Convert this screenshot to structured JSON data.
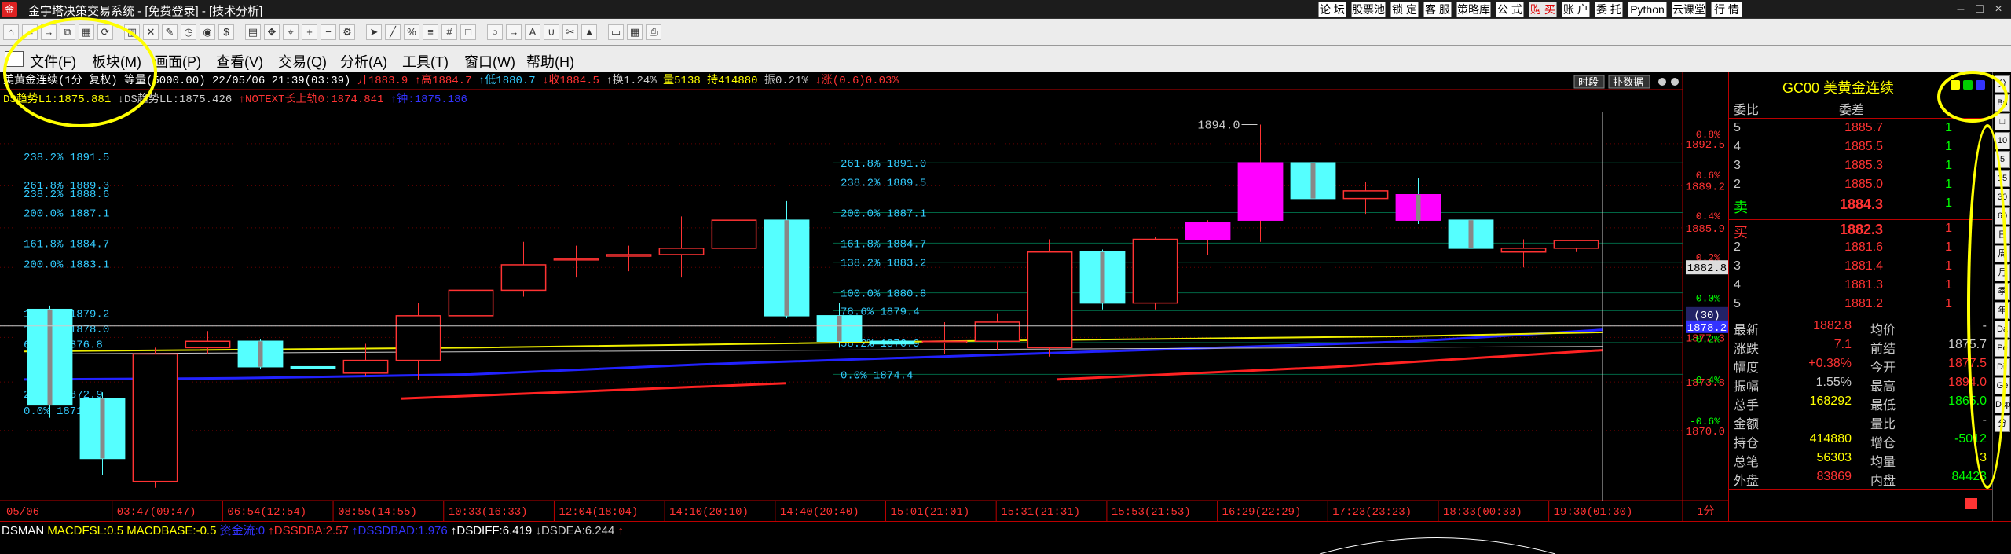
{
  "window": {
    "title": "金宇塔决策交易系统 - [免费登录] - [技术分析]",
    "app_icon": "app-logo-icon",
    "buttons": [
      "论 坛",
      "股票池",
      "锁 定",
      "客 服",
      "策略库",
      "公 式",
      "购 买",
      "账 户",
      "委 托",
      "Python",
      "云课堂",
      "行 情"
    ],
    "minimize": "–",
    "maximize": "□",
    "close": "×"
  },
  "toolbar": {
    "icons": [
      "home-icon",
      "back-icon",
      "forward-icon",
      "copy-icon",
      "grid-icon",
      "refresh-icon",
      "chart-type-icon",
      "trash-icon",
      "edit-icon",
      "clock-icon",
      "record-icon",
      "dollar-icon",
      "layout-icon",
      "move-icon",
      "crosshair-icon",
      "zoom-in-icon",
      "zoom-out-icon",
      "gear-icon",
      "cursor-icon",
      "line-icon",
      "percent-icon",
      "bars-icon",
      "grid-lines-icon",
      "rect-icon",
      "circle-icon",
      "arrow-icon",
      "text-icon",
      "magnet-icon",
      "cut-icon",
      "brush-icon",
      "box-icon",
      "calendar-icon",
      "print-icon"
    ]
  },
  "menu": {
    "items": [
      "文件(F)",
      "板块(M)",
      "画面(P)",
      "查看(V)",
      "交易(Q)",
      "分析(A)",
      "工具(T)",
      "窗口(W)",
      "帮助(H)"
    ]
  },
  "chart": {
    "info_line": "美黄金连续(1分 复权) 等量(5000.00) 22/05/06 21:39(03:39)",
    "quote_parts": [
      {
        "text": "开1883.9",
        "color": "#f33"
      },
      {
        "text": "↑高1884.7",
        "color": "#f33"
      },
      {
        "text": "↑低1880.7",
        "color": "#3cf"
      },
      {
        "text": "↓收1884.5",
        "color": "#f33"
      },
      {
        "text": "↑换1.24%",
        "color": "#ccc"
      },
      {
        "text": "量5138",
        "color": "#ff0"
      },
      {
        "text": "持414880",
        "color": "#ff0"
      },
      {
        "text": "振0.21%",
        "color": "#ccc"
      },
      {
        "text": "↓涨(0.6)0.03%",
        "color": "#f33"
      }
    ],
    "indicator_line": [
      {
        "text": "DS趋势L1:1875.881",
        "color": "#ff0"
      },
      {
        "text": "↓DS趋势LL:1875.426",
        "color": "#ccc"
      },
      {
        "text": "↑NOTEXT长上轨0:1874.841",
        "color": "#f33"
      },
      {
        "text": "↑钟:1875.186",
        "color": "#33f"
      }
    ],
    "top_buttons": [
      "时段",
      "扑数据"
    ],
    "price_scale": [
      "1892.5",
      "1889.2",
      "1885.9",
      "1882.8",
      "1878.2",
      "1877.3",
      "1873.8",
      "1870.0"
    ],
    "percent_scale": [
      "0.8%",
      "0.6%",
      "0.4%",
      "0.2%",
      "0.0%",
      "-0.2%",
      "-0.4%",
      "-0.6%"
    ],
    "last_price_tag": "1882.8",
    "period_tag": "(30)",
    "high_label": "1894.0",
    "time_labels": [
      "05/06",
      "03:47(09:47)",
      "06:54(12:54)",
      "08:55(14:55)",
      "10:33(16:33)",
      "12:04(18:04)",
      "14:10(20:10)",
      "14:40(20:40)",
      "15:01(21:01)",
      "15:31(21:31)",
      "15:53(21:53)",
      "16:29(22:29)",
      "17:23(23:23)",
      "18:33(00:33)",
      "19:30(01:30)"
    ],
    "time_end": "1分",
    "fib_left": [
      "238.2% 1891.5",
      "261.8% 1889.3",
      "238.2% 1888.6",
      "200.0% 1887.1",
      "161.8% 1884.7",
      "200.0% 1883.1",
      "161.8% 1879.2",
      "100.0% 1878.0",
      "61.8% 1876.8",
      "23.6% 1872.9",
      "0.0% 1871.6"
    ],
    "fib_mid": [
      "261.8% 1891.0",
      "238.2% 1889.5",
      "200.0% 1887.1",
      "161.8% 1884.7",
      "138.2% 1883.2",
      "100.0% 1880.8",
      "78.6% 1879.4",
      "58.2% 1876.9",
      "0.0% 1874.4"
    ],
    "candles": [
      {
        "o": 1879.5,
        "c": 1872.0,
        "h": 1879.8,
        "l": 1871.0
      },
      {
        "o": 1872.5,
        "c": 1867.8,
        "h": 1873.0,
        "l": 1866.5
      },
      {
        "o": 1866.0,
        "c": 1876.0,
        "h": 1876.5,
        "l": 1865.5
      },
      {
        "o": 1876.5,
        "c": 1877.0,
        "h": 1877.8,
        "l": 1876.0
      },
      {
        "o": 1877.0,
        "c": 1875.0,
        "h": 1877.2,
        "l": 1874.8
      },
      {
        "o": 1875.0,
        "c": 1874.9,
        "h": 1876.5,
        "l": 1874.5
      },
      {
        "o": 1874.5,
        "c": 1875.5,
        "h": 1876.8,
        "l": 1874.3
      },
      {
        "o": 1875.5,
        "c": 1879.0,
        "h": 1880.0,
        "l": 1874.0
      },
      {
        "o": 1879.0,
        "c": 1881.0,
        "h": 1883.5,
        "l": 1878.5
      },
      {
        "o": 1881.0,
        "c": 1883.0,
        "h": 1884.8,
        "l": 1880.5
      },
      {
        "o": 1883.5,
        "c": 1883.5,
        "h": 1884.5,
        "l": 1882.0
      },
      {
        "o": 1883.8,
        "c": 1883.8,
        "h": 1884.5,
        "l": 1882.5
      },
      {
        "o": 1883.8,
        "c": 1884.3,
        "h": 1886.8,
        "l": 1882.0
      },
      {
        "o": 1884.3,
        "c": 1886.5,
        "h": 1888.8,
        "l": 1884.0
      },
      {
        "o": 1886.5,
        "c": 1879.0,
        "h": 1888.0,
        "l": 1878.8
      },
      {
        "o": 1879.0,
        "c": 1877.0,
        "h": 1880.0,
        "l": 1876.5
      },
      {
        "o": 1877.0,
        "c": 1876.8,
        "h": 1877.8,
        "l": 1876.5
      },
      {
        "o": 1877.0,
        "c": 1877.0,
        "h": 1878.5,
        "l": 1876.0
      },
      {
        "o": 1877.0,
        "c": 1878.5,
        "h": 1879.2,
        "l": 1876.3
      },
      {
        "o": 1876.5,
        "c": 1884.0,
        "h": 1885.0,
        "l": 1875.8
      },
      {
        "o": 1884.0,
        "c": 1880.0,
        "h": 1884.2,
        "l": 1879.5
      },
      {
        "o": 1880.0,
        "c": 1885.0,
        "h": 1885.2,
        "l": 1879.5
      },
      {
        "o": 1885.0,
        "c": 1886.3,
        "h": 1886.5,
        "l": 1883.8
      },
      {
        "o": 1886.5,
        "c": 1891.0,
        "h": 1894.0,
        "l": 1884.8
      },
      {
        "o": 1891.0,
        "c": 1888.2,
        "h": 1892.5,
        "l": 1887.8
      },
      {
        "o": 1888.2,
        "c": 1888.8,
        "h": 1889.5,
        "l": 1887.0
      },
      {
        "o": 1888.5,
        "c": 1886.5,
        "h": 1889.8,
        "l": 1886.2
      },
      {
        "o": 1886.5,
        "c": 1884.3,
        "h": 1886.8,
        "l": 1883.0
      },
      {
        "o": 1884.0,
        "c": 1884.3,
        "h": 1885.0,
        "l": 1882.8
      },
      {
        "o": 1884.3,
        "c": 1884.9,
        "h": 1884.9,
        "l": 1884.0
      }
    ]
  },
  "quote_panel": {
    "title": "GC00 美黄金连续",
    "header_icons": [
      "menu-icon",
      "refresh-icon",
      "sort-icon"
    ],
    "col_a": "委比",
    "col_b": "委差",
    "asks": [
      {
        "n": "5",
        "p": "1885.7",
        "v": "1"
      },
      {
        "n": "4",
        "p": "1885.5",
        "v": "1"
      },
      {
        "n": "3",
        "p": "1885.3",
        "v": "1"
      },
      {
        "n": "2",
        "p": "1885.0",
        "v": "1"
      },
      {
        "n": "卖",
        "p": "1884.3",
        "v": "1"
      }
    ],
    "bids": [
      {
        "n": "买",
        "p": "1882.3",
        "v": "1"
      },
      {
        "n": "2",
        "p": "1881.6",
        "v": "1"
      },
      {
        "n": "3",
        "p": "1881.4",
        "v": "1"
      },
      {
        "n": "4",
        "p": "1881.3",
        "v": "1"
      },
      {
        "n": "5",
        "p": "1881.2",
        "v": "1"
      }
    ],
    "stats": [
      {
        "l1": "最新",
        "v1": "1882.8",
        "c1": "#f33",
        "l2": "均价",
        "v2": "-",
        "c2": "#ccc"
      },
      {
        "l1": "涨跌",
        "v1": "7.1",
        "c1": "#f33",
        "l2": "前结",
        "v2": "1875.7",
        "c2": "#ccc"
      },
      {
        "l1": "幅度",
        "v1": "+0.38%",
        "c1": "#f33",
        "l2": "今开",
        "v2": "1877.5",
        "c2": "#f33"
      },
      {
        "l1": "振幅",
        "v1": "1.55%",
        "c1": "#ccc",
        "l2": "最高",
        "v2": "1894.0",
        "c2": "#f33"
      },
      {
        "l1": "总手",
        "v1": "168292",
        "c1": "#ff0",
        "l2": "最低",
        "v2": "1865.0",
        "c2": "#0f0"
      },
      {
        "l1": "金额",
        "v1": "",
        "c1": "#ccc",
        "l2": "量比",
        "v2": "-",
        "c2": "#ccc"
      },
      {
        "l1": "持仓",
        "v1": "414880",
        "c1": "#ff0",
        "l2": "增仓",
        "v2": "-5012",
        "c2": "#0f0"
      },
      {
        "l1": "总笔",
        "v1": "56303",
        "c1": "#ff0",
        "l2": "均量",
        "v2": "3",
        "c2": "#ff0"
      },
      {
        "l1": "外盘",
        "v1": "83869",
        "c1": "#f33",
        "l2": "内盘",
        "v2": "84423",
        "c2": "#0f0"
      }
    ],
    "footer_icon": "flag-icon"
  },
  "side_tabs": [
    "分",
    "Bri",
    "□",
    "10",
    "5",
    "15",
    "30",
    "60",
    "日",
    "周",
    "月",
    "季",
    "年",
    "Da",
    "Pe",
    "Dir",
    "Ge",
    "Dsp",
    "分"
  ],
  "bottom": {
    "label": "DSMAN",
    "items": [
      {
        "text": "MACDFSL:0.5",
        "color": "#ff0"
      },
      {
        "text": "MACDBASE:-0.5",
        "color": "#ff0"
      },
      {
        "text": "资金流:0",
        "color": "#33f"
      },
      {
        "text": "↑DSSDBA:2.57",
        "color": "#f33"
      },
      {
        "text": "↑DSSDBAD:1.976",
        "color": "#33f"
      },
      {
        "text": "↑DSDIFF:6.419",
        "color": "#fff"
      },
      {
        "text": "↓DSDEA:6.244",
        "color": "#ccc"
      },
      {
        "text": "↑",
        "color": "#f33"
      }
    ]
  }
}
